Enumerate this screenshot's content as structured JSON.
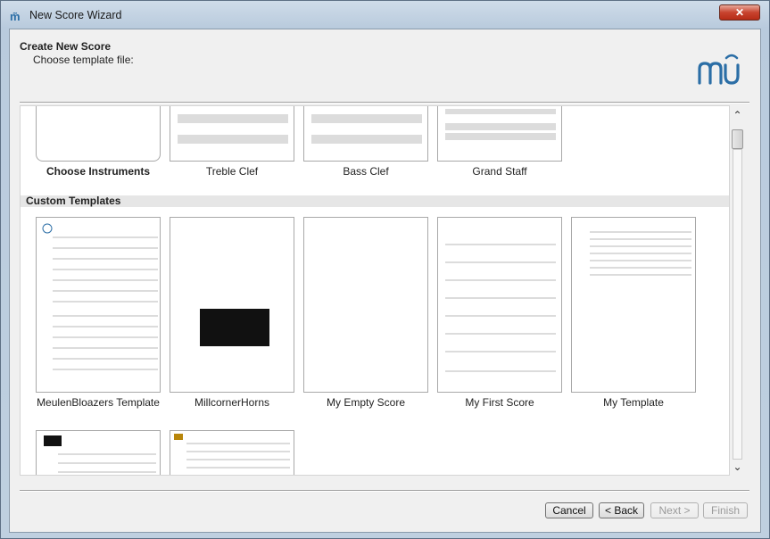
{
  "window": {
    "title": "New Score Wizard",
    "close_glyph": "✕"
  },
  "header": {
    "title": "Create New Score",
    "subtitle": "Choose template file:"
  },
  "logo": {
    "icon": "musescore-logo-icon"
  },
  "templates_top": [
    {
      "name": "Choose Instruments"
    },
    {
      "name": "Treble Clef"
    },
    {
      "name": "Bass Clef"
    },
    {
      "name": "Grand Staff"
    }
  ],
  "section": {
    "custom_label": "Custom Templates"
  },
  "custom_templates": [
    {
      "name": "MeulenBloazers Template"
    },
    {
      "name": "MillcornerHorns"
    },
    {
      "name": "My Empty Score"
    },
    {
      "name": "My First Score"
    },
    {
      "name": "My Template"
    }
  ],
  "buttons": {
    "cancel": "Cancel",
    "back": "< Back",
    "next": "Next >",
    "finish": "Finish"
  },
  "colors": {
    "accent": "#2b6ea6",
    "section_bg": "#e6e6e6"
  }
}
